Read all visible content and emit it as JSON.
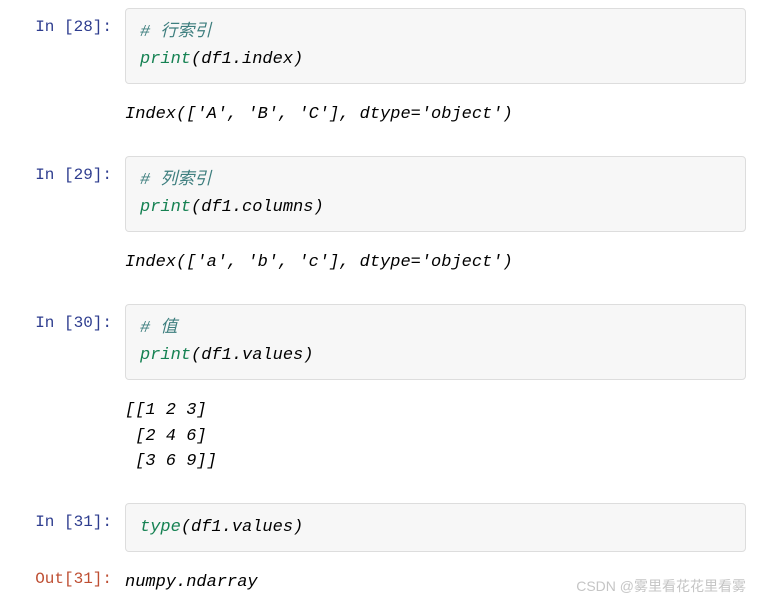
{
  "cells": [
    {
      "in_prompt": "In  [28]:",
      "code": {
        "comment": "# 行索引",
        "func": "print",
        "open": "(",
        "arg": "df1.index",
        "close": ")"
      },
      "output": "Index(['A', 'B', 'C'], dtype='object')"
    },
    {
      "in_prompt": "In  [29]:",
      "code": {
        "comment": "# 列索引",
        "func": "print",
        "open": "(",
        "arg": "df1.columns",
        "close": ")"
      },
      "output": "Index(['a', 'b', 'c'], dtype='object')"
    },
    {
      "in_prompt": "In  [30]:",
      "code": {
        "comment": "# 值",
        "func": "print",
        "open": "(",
        "arg": "df1.values",
        "close": ")"
      },
      "output": "[[1 2 3]\n [2 4 6]\n [3 6 9]]"
    },
    {
      "in_prompt": "In  [31]:",
      "code": {
        "comment": "",
        "func": "type",
        "open": "(",
        "arg": "df1.values",
        "close": ")"
      },
      "out_prompt": "Out[31]:",
      "result": "numpy.ndarray"
    }
  ],
  "watermark": "CSDN @雾里看花花里看雾"
}
